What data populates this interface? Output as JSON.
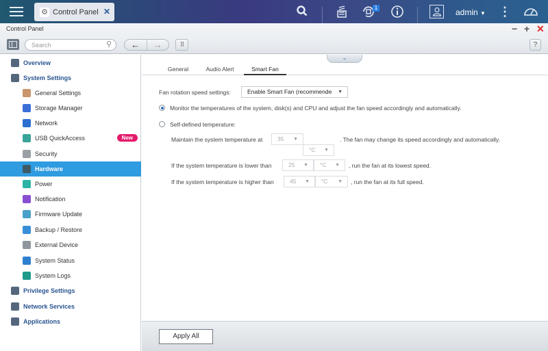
{
  "topbar": {
    "app_tab_label": "Control Panel",
    "notification_count": "1",
    "username": "admin",
    "icons": [
      "menu-icon",
      "gear-icon",
      "close-icon",
      "search-icon",
      "task-stack-icon",
      "event-notification-icon",
      "info-icon",
      "user-icon",
      "more-vertical-icon",
      "dashboard-gauge-icon"
    ]
  },
  "window": {
    "title": "Control Panel",
    "controls": {
      "minimize": "−",
      "maximize": "+",
      "close": "✕"
    }
  },
  "toolbar": {
    "search_placeholder": "Search",
    "back": "←",
    "forward": "→",
    "apps_grid": "⠿",
    "help": "?"
  },
  "sidebar": {
    "items": [
      {
        "label": "Overview",
        "level": "top",
        "icon": "overview-icon",
        "color": "#55677d"
      },
      {
        "label": "System Settings",
        "level": "top",
        "icon": "gear-icon",
        "color": "#55677d"
      },
      {
        "label": "General Settings",
        "level": "sub",
        "icon": "general-settings-icon",
        "color": "#c9956a"
      },
      {
        "label": "Storage Manager",
        "level": "sub",
        "icon": "storage-icon",
        "color": "#3b6fd8"
      },
      {
        "label": "Network",
        "level": "sub",
        "icon": "network-icon",
        "color": "#2b6fd0"
      },
      {
        "label": "USB QuickAccess",
        "level": "sub",
        "icon": "usb-icon",
        "color": "#3aa39a",
        "badge": "New"
      },
      {
        "label": "Security",
        "level": "sub",
        "icon": "lock-icon",
        "color": "#9aa0a6"
      },
      {
        "label": "Hardware",
        "level": "sub",
        "icon": "hardware-icon",
        "color": "#3d5a66",
        "active": true
      },
      {
        "label": "Power",
        "level": "sub",
        "icon": "power-bulb-icon",
        "color": "#2bb3a6"
      },
      {
        "label": "Notification",
        "level": "sub",
        "icon": "notification-icon",
        "color": "#8a4fd0"
      },
      {
        "label": "Firmware Update",
        "level": "sub",
        "icon": "firmware-update-icon",
        "color": "#4aa0c9"
      },
      {
        "label": "Backup / Restore",
        "level": "sub",
        "icon": "backup-restore-icon",
        "color": "#3a8fd8"
      },
      {
        "label": "External Device",
        "level": "sub",
        "icon": "external-device-icon",
        "color": "#8f969d"
      },
      {
        "label": "System Status",
        "level": "sub",
        "icon": "system-status-icon",
        "color": "#2e7fd0"
      },
      {
        "label": "System Logs",
        "level": "sub",
        "icon": "system-logs-icon",
        "color": "#1f9a8a"
      },
      {
        "label": "Privilege Settings",
        "level": "top",
        "icon": "user-icon",
        "color": "#55677d"
      },
      {
        "label": "Network Services",
        "level": "top",
        "icon": "globe-icon",
        "color": "#55677d"
      },
      {
        "label": "Applications",
        "level": "top",
        "icon": "applications-icon",
        "color": "#55677d"
      }
    ]
  },
  "main": {
    "collapse": "⌄",
    "tabs": [
      {
        "label": "General"
      },
      {
        "label": "Audio Alert"
      },
      {
        "label": "Smart Fan",
        "active": true
      }
    ],
    "fan_rotation": {
      "label": "Fan rotation speed settings:",
      "value": "Enable Smart Fan (recommende"
    },
    "option_auto": {
      "label": "Monitor the temperatures of the system, disk(s) and CPU and adjust the fan speed accordingly and automatically.",
      "checked": true
    },
    "option_self": {
      "label": "Self-defined temperature:",
      "checked": false
    },
    "maintain": {
      "prefix": "Maintain the system temperature at",
      "value": "35",
      "unit": "°C",
      "suffix": ". The fan may change its speed accordingly and automatically."
    },
    "lower": {
      "prefix": "If the system temperature is lower than",
      "value": "25",
      "unit": "°C",
      "suffix": ", run the fan at its lowest speed."
    },
    "higher": {
      "prefix": "If the system temperature is higher than",
      "value": "45",
      "unit": "°C",
      "suffix": ", run the fan at its full speed."
    },
    "apply_label": "Apply All"
  }
}
